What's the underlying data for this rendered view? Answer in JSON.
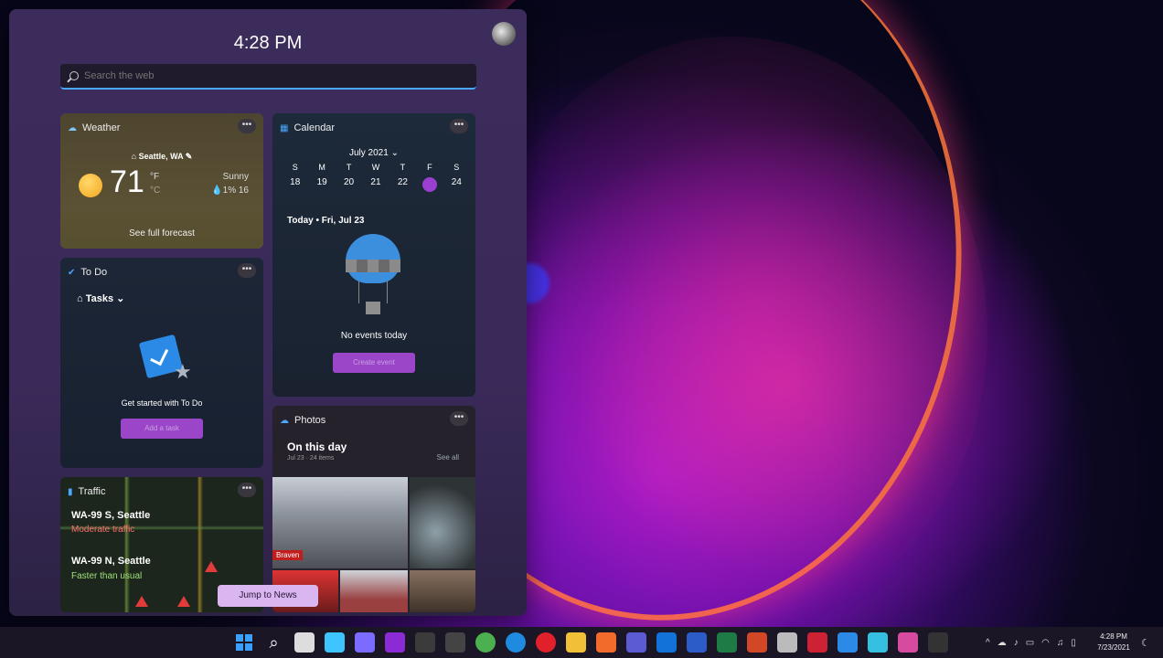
{
  "widgets": {
    "time": "4:28 PM",
    "search_placeholder": "Search the web",
    "weather": {
      "title": "Weather",
      "location": "Seattle, WA",
      "temp": "71",
      "unit_f": "°F",
      "unit_c": "°C",
      "condition": "Sunny",
      "details": "1%  16",
      "forecast_link": "See full forecast"
    },
    "calendar": {
      "title": "Calendar",
      "month": "July 2021",
      "weekdays": [
        "S",
        "M",
        "T",
        "W",
        "T",
        "F",
        "S"
      ],
      "days": [
        "18",
        "19",
        "20",
        "21",
        "22",
        "23",
        "24"
      ],
      "selected_day": "23",
      "today": "Today • Fri, Jul 23",
      "no_events": "No events today",
      "create_event": "Create event"
    },
    "todo": {
      "title": "To Do",
      "list_name": "Tasks",
      "message": "Get started with To Do",
      "add_task": "Add a task"
    },
    "photos": {
      "title": "Photos",
      "heading": "On this day",
      "sub": "Jul 23 · 24 items",
      "see_all": "See all",
      "tag": "Braven"
    },
    "traffic": {
      "title": "Traffic",
      "routes": [
        {
          "name": "WA-99 S, Seattle",
          "status": "Moderate traffic",
          "color": "#ff6b6b"
        },
        {
          "name": "WA-99 N, Seattle",
          "status": "Faster than usual",
          "color": "#9ee27a"
        }
      ]
    },
    "jump_to_news": "Jump to News",
    "more_label": "•••"
  },
  "taskbar": {
    "icons": [
      {
        "name": "start",
        "color": "#3aa0ff"
      },
      {
        "name": "search",
        "color": "#ffffff"
      },
      {
        "name": "task-view",
        "color": "#dddddd"
      },
      {
        "name": "widgets",
        "color": "#3ec4ff"
      },
      {
        "name": "chat",
        "color": "#7b6cff"
      },
      {
        "name": "onenote",
        "color": "#8b2bd6"
      },
      {
        "name": "app-a",
        "color": "#3b3b3b"
      },
      {
        "name": "app-b",
        "color": "#444444"
      },
      {
        "name": "chrome",
        "color": "#4caf50"
      },
      {
        "name": "edge",
        "color": "#1e8be0"
      },
      {
        "name": "opera",
        "color": "#e0202b"
      },
      {
        "name": "file-explorer",
        "color": "#f2c037"
      },
      {
        "name": "brave",
        "color": "#f26b2b"
      },
      {
        "name": "teams",
        "color": "#5d5bd4"
      },
      {
        "name": "outlook",
        "color": "#1272d8"
      },
      {
        "name": "word",
        "color": "#2b5cc7"
      },
      {
        "name": "excel",
        "color": "#1e7b45"
      },
      {
        "name": "powerpoint",
        "color": "#d24726"
      },
      {
        "name": "app-c",
        "color": "#bbbbbb"
      },
      {
        "name": "app-d",
        "color": "#cc2233"
      },
      {
        "name": "todo",
        "color": "#2b8ae6"
      },
      {
        "name": "app-e",
        "color": "#36c0e0"
      },
      {
        "name": "app-f",
        "color": "#d64aa0"
      },
      {
        "name": "app-g",
        "color": "#333333"
      }
    ],
    "tray_time": "4:28 PM",
    "tray_date": "7/23/2021"
  }
}
